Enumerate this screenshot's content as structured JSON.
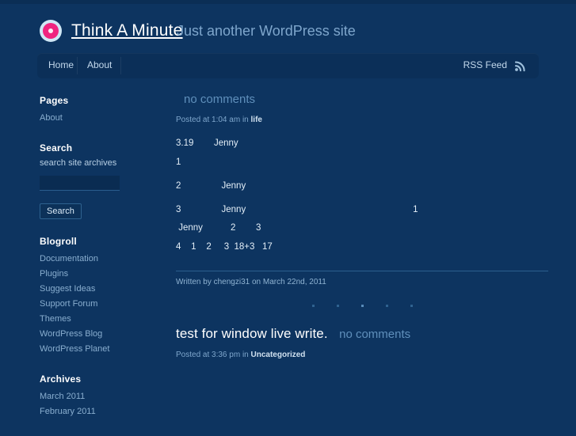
{
  "header": {
    "logo_icon": "circle-target-icon",
    "site_title": "Think A Minute",
    "site_description": "Just another WordPress site"
  },
  "nav": {
    "items": [
      {
        "label": "Home",
        "name": "nav-home"
      },
      {
        "label": "About",
        "name": "nav-about"
      }
    ],
    "rss_label": "RSS Feed",
    "rss_icon": "rss-icon"
  },
  "sidebar": {
    "pages": {
      "heading": "Pages",
      "items": [
        "About"
      ]
    },
    "search": {
      "heading": "Search",
      "label": "search site archives",
      "input_value": "",
      "input_placeholder": "",
      "button_label": "Search"
    },
    "blogroll": {
      "heading": "Blogroll",
      "items": [
        "Documentation",
        "Plugins",
        "Suggest Ideas",
        "Support Forum",
        "Themes",
        "WordPress Blog",
        "WordPress Planet"
      ]
    },
    "archives": {
      "heading": "Archives",
      "items": [
        "March 2011",
        "February 2011"
      ]
    }
  },
  "content": {
    "posts": [
      {
        "title": "",
        "comments_label": "no comments",
        "meta_prefix": "Posted at 1:04 am in ",
        "meta_category": "life",
        "body_lines": [
          "3.19        Jenny",
          "",
          "1",
          "2                Jenny",
          "3                Jenny                                                                  1",
          " Jenny           2        3",
          "4    1    2     3  18+3   17"
        ],
        "footer_prefix": "Written by ",
        "footer_author": "chengzi31",
        "footer_middle": " on ",
        "footer_date": "March 22nd, 2011"
      },
      {
        "title": "test for window live write.",
        "comments_label": "no comments",
        "meta_prefix": "Posted at 3:36 pm in ",
        "meta_category": "Uncategorized"
      }
    ]
  },
  "colors": {
    "background": "#0d3460",
    "navbar": "#0b2f58",
    "accent_pink": "#f0247f",
    "link_blue": "#89aecf",
    "text_white": "#ffffff"
  }
}
